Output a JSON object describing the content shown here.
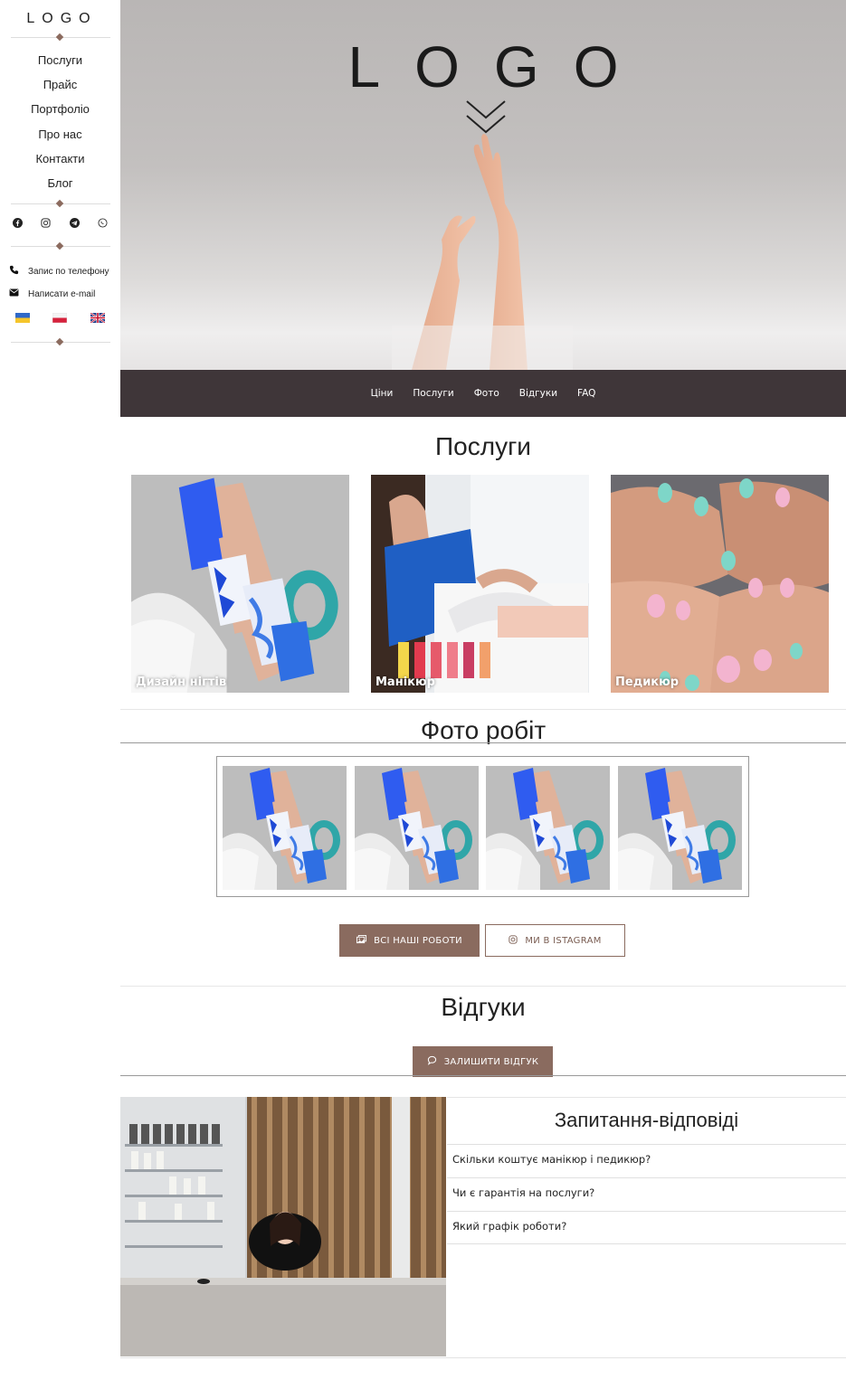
{
  "sidebar": {
    "logo": "LOGO",
    "menu": [
      "Послуги",
      "Прайс",
      "Портфоліо",
      "Про нас",
      "Контакти",
      "Блог"
    ],
    "social_icons": [
      "facebook-icon",
      "instagram-icon",
      "telegram-icon",
      "viber-icon"
    ],
    "phone_label": "Запис по телефону",
    "email_label": "Написати e-mail",
    "languages": [
      "ua",
      "pl",
      "gb"
    ]
  },
  "hero": {
    "logo": "LOGO"
  },
  "topnav": [
    "Ціни",
    "Послуги",
    "Фото",
    "Відгуки",
    "FAQ"
  ],
  "services": {
    "title": "Послуги",
    "items": [
      {
        "label": "Дизайн нігтів"
      },
      {
        "label": "Манікюр"
      },
      {
        "label": "Педикюр"
      }
    ]
  },
  "photos": {
    "title": "Фото робіт",
    "all_works_label": "ВСІ НАШІ РОБОТИ",
    "instagram_label": "МИ В ISTAGRAM"
  },
  "reviews": {
    "title": "Відгуки",
    "leave_review_label": "ЗАЛИШИТИ ВІДГУК"
  },
  "faq": {
    "title": "Запитання-відповіді",
    "items": [
      "Скільки коштує манікюр і педикюр?",
      "Чи є гарантія на послуги?",
      "Який графік роботи?"
    ]
  },
  "colors": {
    "accent": "#8a6b5f",
    "nav_bg": "#3f3639"
  }
}
